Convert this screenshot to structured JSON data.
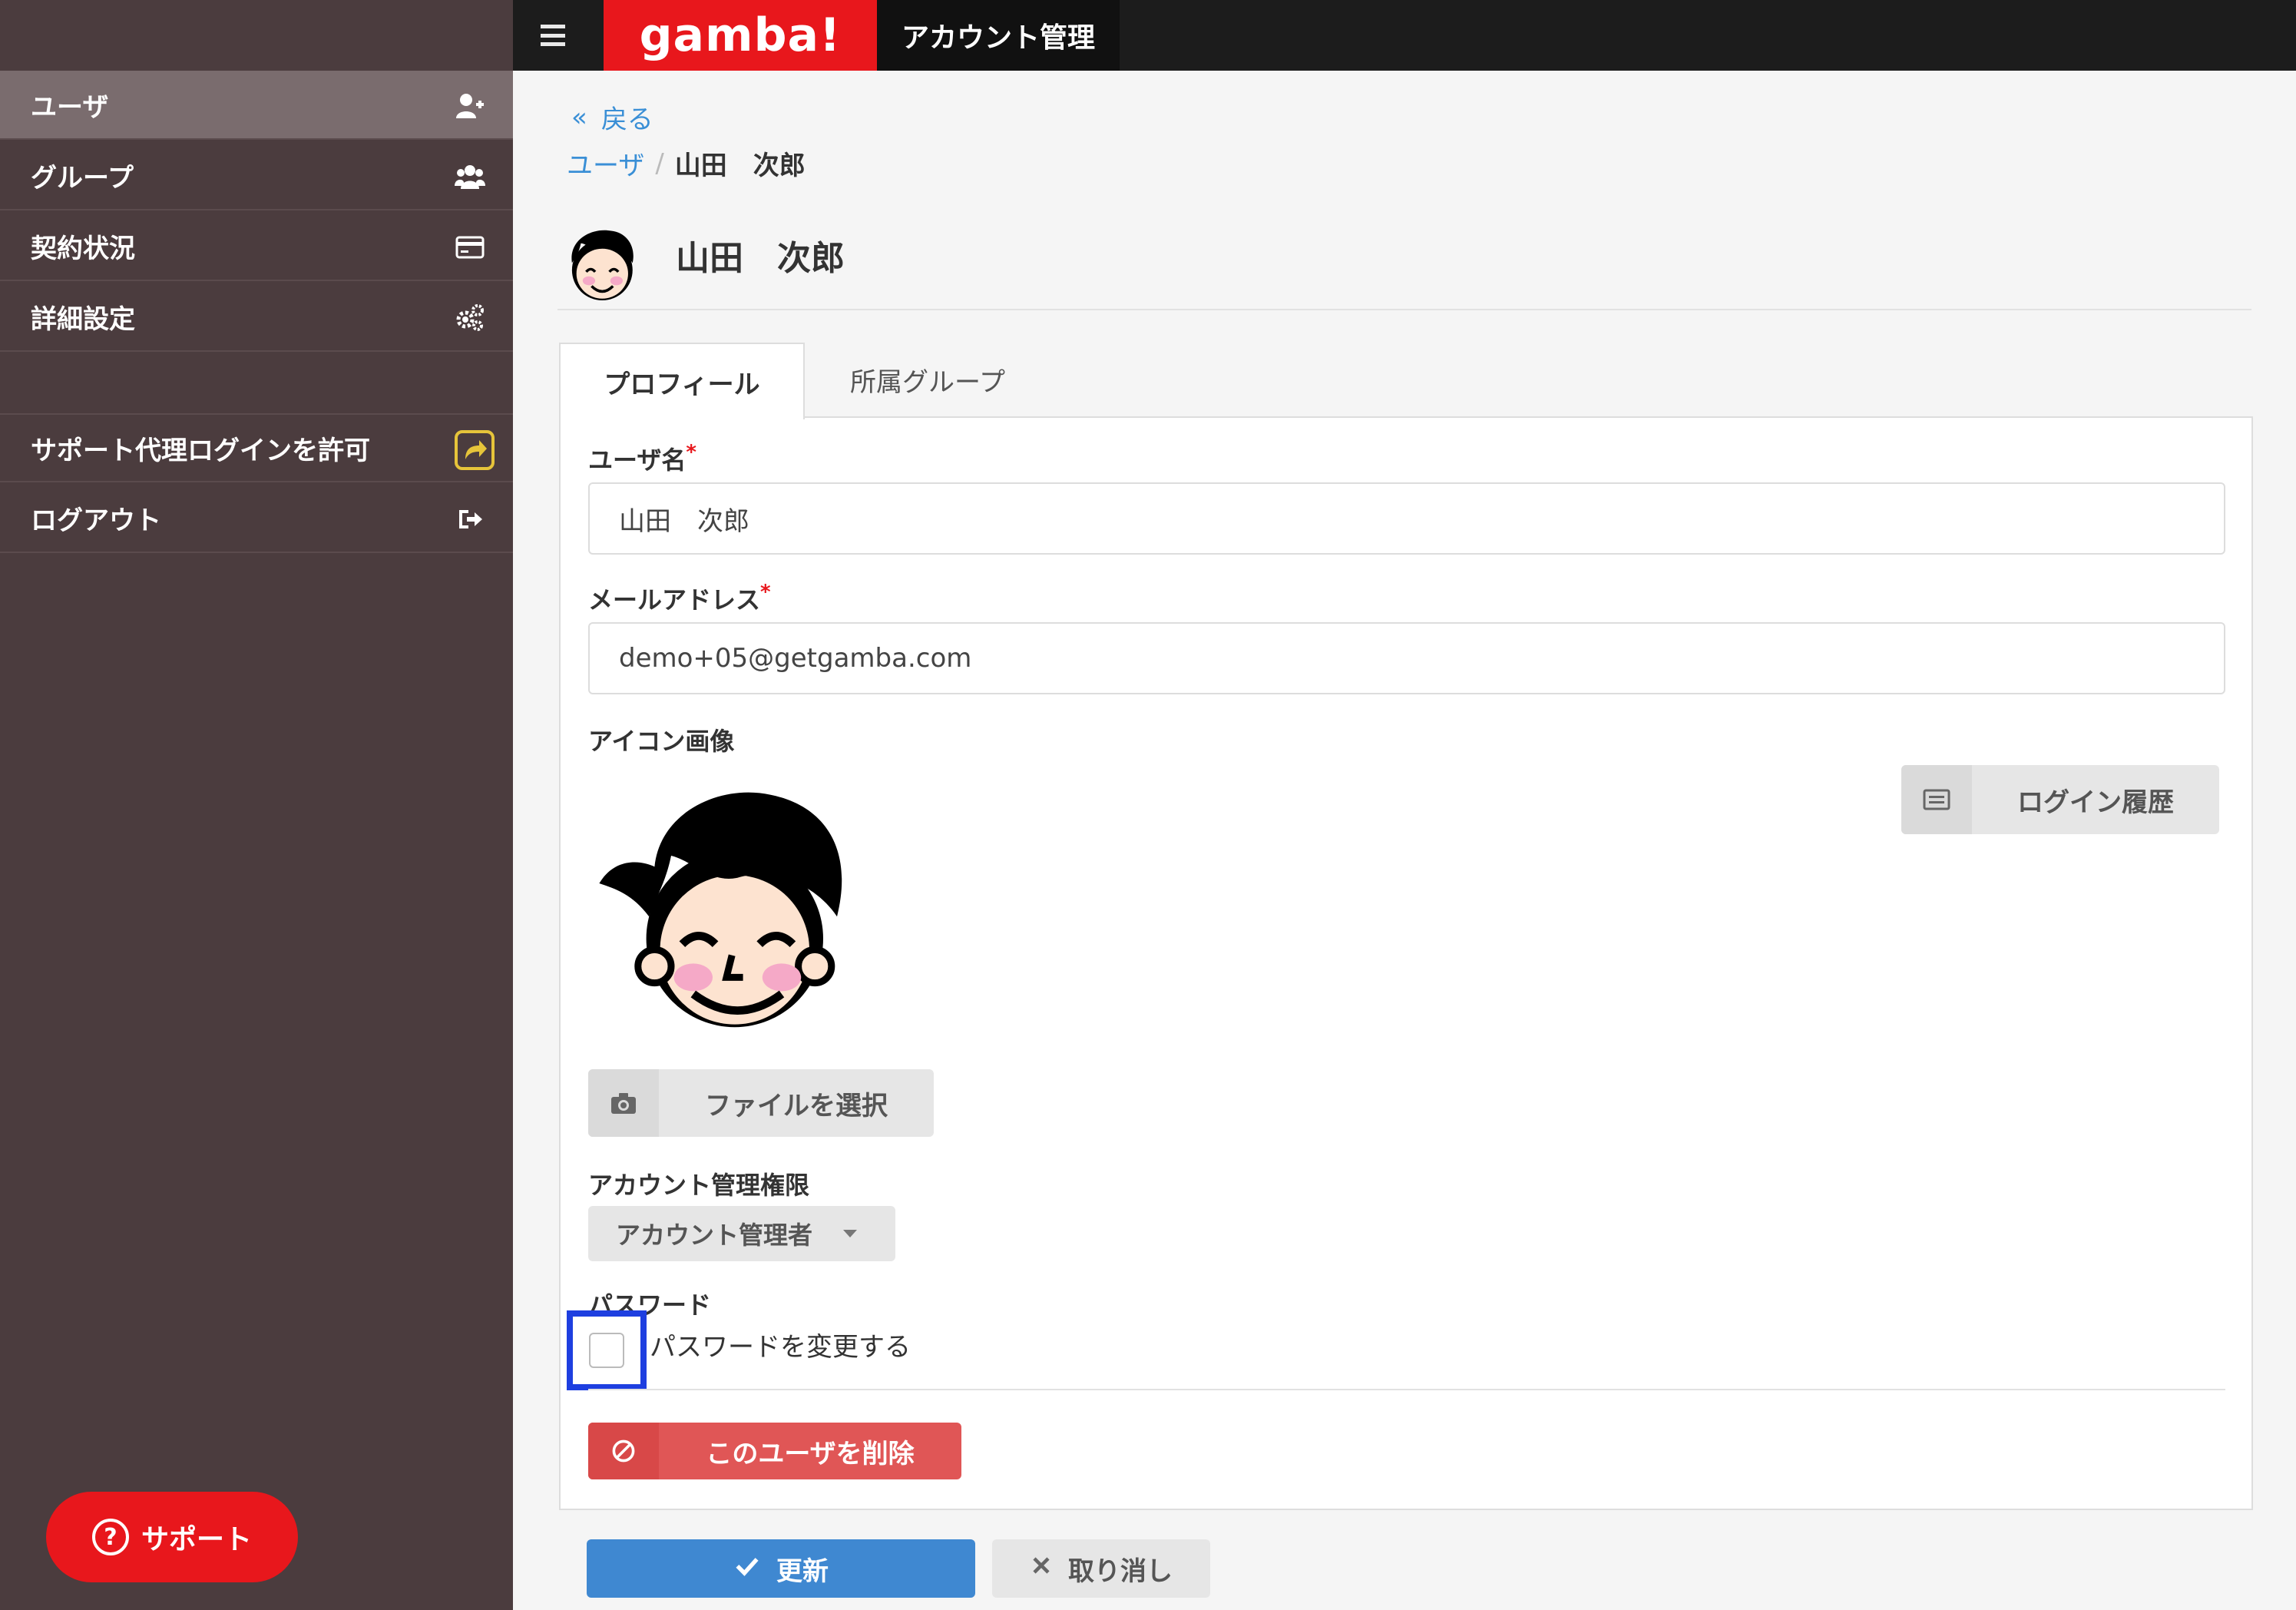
{
  "topbar": {
    "menu_icon": "hamburger-icon",
    "logo_text": "gamba!",
    "app_title": "アカウント管理"
  },
  "sidebar": {
    "items": [
      {
        "label": "ユーザ",
        "icon": "user-plus-icon",
        "active": true
      },
      {
        "label": "グループ",
        "icon": "users-icon"
      },
      {
        "label": "契約状況",
        "icon": "credit-card-icon"
      },
      {
        "label": "詳細設定",
        "icon": "gears-icon"
      },
      {
        "label": "サポート代理ログインを許可",
        "icon": "share-square-icon"
      },
      {
        "label": "ログアウト",
        "icon": "sign-out-icon"
      }
    ],
    "support_button": {
      "label": "サポート",
      "icon": "question-circle-icon"
    }
  },
  "main": {
    "back_link": "戻る",
    "breadcrumb": {
      "parent": "ユーザ",
      "separator": "/",
      "current": "山田　次郎"
    },
    "header_name": "山田　次郎",
    "tabs": [
      {
        "label": "プロフィール",
        "active": true
      },
      {
        "label": "所属グループ"
      }
    ],
    "form": {
      "username_label": "ユーザ名",
      "username_value": "山田　次郎",
      "required_mark": "*",
      "email_label": "メールアドレス",
      "email_value": "demo+05@getgamba.com",
      "icon_label": "アイコン画像",
      "login_history_button": "ログイン履歴",
      "choose_file_button": "ファイルを選択",
      "permission_label": "アカウント管理権限",
      "permission_selected": "アカウント管理者",
      "password_label": "パスワード",
      "password_change_label": "パスワードを変更する",
      "password_change_checked": false,
      "delete_button": "このユーザを削除"
    },
    "update_button": "更新",
    "cancel_button": "取り消し"
  },
  "colors": {
    "brand_red": "#e8171c",
    "sidebar_bg": "#4b3c3e",
    "link_blue": "#3a8fd6",
    "primary_blue": "#3f88d1",
    "danger_red": "#e05656",
    "highlight_blue": "#1e3fe0"
  }
}
